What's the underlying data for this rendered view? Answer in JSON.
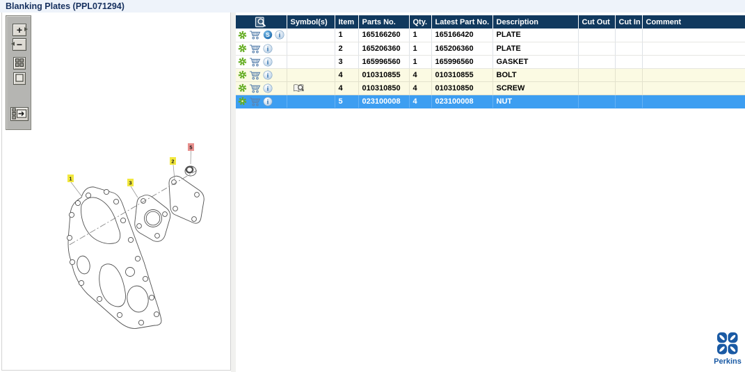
{
  "title": "Blanking Plates (PPL071294)",
  "toolbar": {
    "buttons": [
      {
        "name": "zoom-in",
        "glyph": "+"
      },
      {
        "name": "zoom-out",
        "glyph": "−"
      },
      {
        "name": "thumbnail-view",
        "glyph": ""
      },
      {
        "name": "single-view",
        "glyph": ""
      },
      {
        "name": "move-panel",
        "glyph": ""
      }
    ]
  },
  "diagram": {
    "labels": [
      {
        "num": "1",
        "part": "PLATE",
        "state": "normal"
      },
      {
        "num": "3",
        "part": "GASKET",
        "state": "normal"
      },
      {
        "num": "2",
        "part": "PLATE",
        "state": "normal"
      },
      {
        "num": "5",
        "part": "NUT",
        "state": "selected"
      }
    ]
  },
  "table": {
    "columns": [
      {
        "key": "icons",
        "label": "",
        "icon": "image-search-icon"
      },
      {
        "key": "symbol",
        "label": "Symbol(s)"
      },
      {
        "key": "item",
        "label": "Item"
      },
      {
        "key": "parts_no",
        "label": "Parts No."
      },
      {
        "key": "qty",
        "label": "Qty."
      },
      {
        "key": "latest_part_no",
        "label": "Latest Part No."
      },
      {
        "key": "description",
        "label": "Description"
      },
      {
        "key": "cut_out",
        "label": "Cut Out"
      },
      {
        "key": "cut_in",
        "label": "Cut In"
      },
      {
        "key": "comment",
        "label": "Comment"
      }
    ],
    "rows": [
      {
        "icons": [
          "gear-icon",
          "cart-icon",
          "s-icon",
          "info-icon"
        ],
        "symbol": "",
        "item": "1",
        "parts_no": "165166260",
        "qty": "1",
        "latest_part_no": "165166420",
        "description": "PLATE",
        "cut_out": "",
        "cut_in": "",
        "comment": "",
        "state": "normal"
      },
      {
        "icons": [
          "gear-icon",
          "cart-icon",
          "info-icon"
        ],
        "symbol": "",
        "item": "2",
        "parts_no": "165206360",
        "qty": "1",
        "latest_part_no": "165206360",
        "description": "PLATE",
        "cut_out": "",
        "cut_in": "",
        "comment": "",
        "state": "normal"
      },
      {
        "icons": [
          "gear-icon",
          "cart-icon",
          "info-icon"
        ],
        "symbol": "",
        "item": "3",
        "parts_no": "165996560",
        "qty": "1",
        "latest_part_no": "165996560",
        "description": "GASKET",
        "cut_out": "",
        "cut_in": "",
        "comment": "",
        "state": "normal"
      },
      {
        "icons": [
          "gear-icon",
          "cart-icon",
          "info-icon"
        ],
        "symbol": "",
        "item": "4",
        "parts_no": "010310855",
        "qty": "4",
        "latest_part_no": "010310855",
        "description": "BOLT",
        "cut_out": "",
        "cut_in": "",
        "comment": "",
        "state": "accent"
      },
      {
        "icons": [
          "gear-icon",
          "cart-icon",
          "info-icon"
        ],
        "symbol": "book-magnifier-icon",
        "item": "4",
        "parts_no": "010310850",
        "qty": "4",
        "latest_part_no": "010310850",
        "description": "SCREW",
        "cut_out": "",
        "cut_in": "",
        "comment": "",
        "state": "accent"
      },
      {
        "icons": [
          "gear-icon",
          "cart-icon",
          "info-icon"
        ],
        "symbol": "",
        "item": "5",
        "parts_no": "023100008",
        "qty": "4",
        "latest_part_no": "023100008",
        "description": "NUT",
        "cut_out": "",
        "cut_in": "",
        "comment": "",
        "state": "selected"
      }
    ]
  },
  "logo": {
    "text": "Perkins"
  },
  "colors": {
    "header_bg": "#11395e",
    "selected_row": "#3d9ef1",
    "accent_row": "#fbfae3",
    "label_yellow": "#f2e83e",
    "label_selected": "#e8908e",
    "logo_blue": "#1a5aa4",
    "gear_green": "#63ac1f"
  }
}
